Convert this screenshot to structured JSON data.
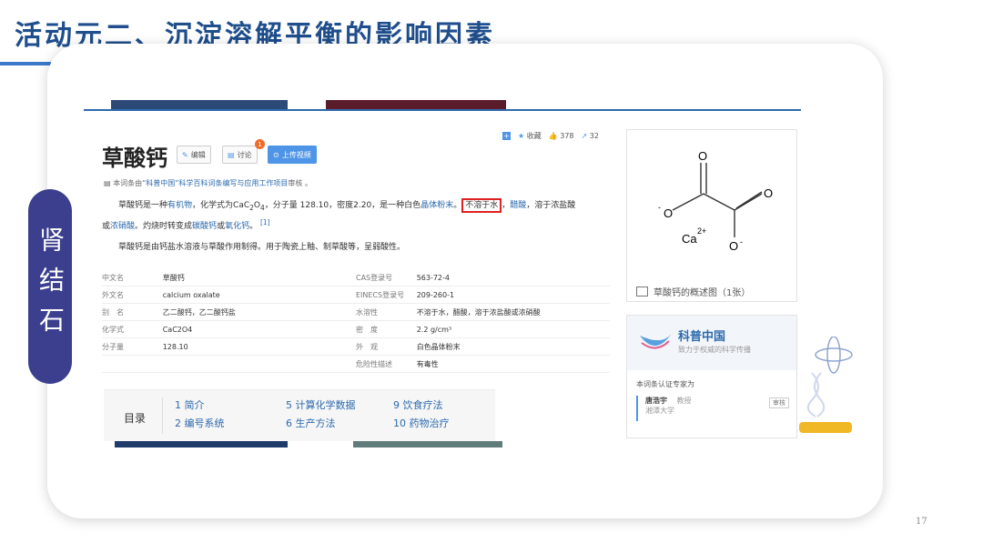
{
  "slide": {
    "title": "活动元二、沉淀溶解平衡的影响因素",
    "side_label": "肾结石",
    "page_number": "17"
  },
  "entry": {
    "title": "草酸钙",
    "edit_label": "编辑",
    "discuss_label": "讨论",
    "discuss_badge": "1",
    "upload_label": "上传视频",
    "toolbar": {
      "collect_label": "收藏",
      "like_count": "378",
      "share_count": "32"
    },
    "note_prefix": "本词条由",
    "note_link": "“科普中国”科学百科词条编写与应用工作项目",
    "note_suffix": "审核 。",
    "paragraph1": {
      "t1": "草酸钙是一种",
      "l1": "有机物",
      "t2": "，化学式为CaC",
      "sub1": "2",
      "t3": "O",
      "sub2": "4",
      "t4": "，分子量 128.10，密度2.20，是一种白色",
      "l2": "晶体粉末",
      "t5": "。",
      "highlight": "不溶于水",
      "l3": "醋酸",
      "t6": "，溶于浓盐酸",
      "t7": "或",
      "l4": "浓硝酸",
      "t8": "。灼烧时转变成",
      "l5": "碳酸钙",
      "t9": "或",
      "l6": "氧化钙",
      "t10": "。",
      "ref": "[1]"
    },
    "paragraph2": "草酸钙是由钙盐水溶液与草酸作用制得。用于陶瓷上釉、制草酸等，呈弱酸性。",
    "infobox": [
      {
        "k1": "中文名",
        "v1": "草酸钙",
        "k2": "CAS登录号",
        "v2": "563-72-4"
      },
      {
        "k1": "外文名",
        "v1": "calcium oxalate",
        "k2": "EINECS登录号",
        "v2": "209-260-1"
      },
      {
        "k1": "别　名",
        "v1": "乙二酸钙，乙二酸钙盐",
        "k2": "水溶性",
        "v2": "不溶于水，醋酸，溶于浓盐酸或浓硝酸"
      },
      {
        "k1": "化学式",
        "v1": "CaC2O4",
        "k2": "密　度",
        "v2": "2.2 g/cm³"
      },
      {
        "k1": "分子量",
        "v1": "128.10",
        "k2": "外　观",
        "v2": "白色晶体粉末"
      },
      {
        "k1": "",
        "v1": "",
        "k2": "危险性描述",
        "v2": "有毒性"
      }
    ],
    "toc": {
      "label": "目录",
      "items": [
        "1 简介",
        "2 编号系统",
        "5 计算化学数据",
        "6 生产方法",
        "9 饮食疗法",
        "10 药物治疗"
      ]
    }
  },
  "structure": {
    "atoms": [
      "O",
      "O",
      "O",
      "O"
    ],
    "minus1": "-",
    "minus2": "-",
    "cation": "Ca",
    "cation_charge": "2+",
    "overview": "草酸钙的概述图（1张）"
  },
  "kepu": {
    "name": "科普中国",
    "slogan": "致力于权威的科学传播",
    "cert": "本词条认证专家为",
    "expert_name": "唐浩宇",
    "expert_title": "教授",
    "expert_org": "湘潭大学",
    "expert_tag": "审核"
  },
  "colors": {
    "accent": "#3b3f8e",
    "title": "#1f4e8c",
    "link": "#2d6aad",
    "highlight_box": "#e02020"
  }
}
